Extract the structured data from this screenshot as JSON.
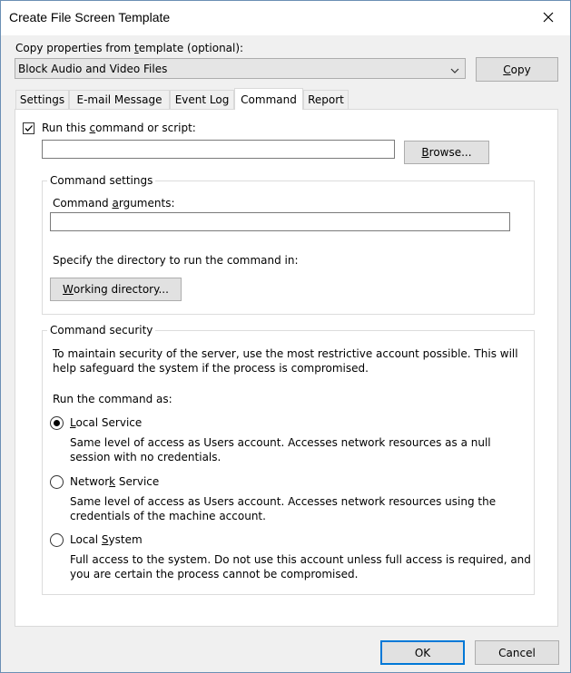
{
  "window": {
    "title": "Create File Screen Template",
    "close_icon": "close-icon"
  },
  "copy_from": {
    "label_pre": "Copy properties from ",
    "label_u": "t",
    "label_post": "emplate (optional):",
    "selected": "Block Audio and Video Files",
    "copy_button_pre": "",
    "copy_button_u": "C",
    "copy_button_post": "opy"
  },
  "tabs": [
    {
      "label": "Settings"
    },
    {
      "label": "E-mail Message"
    },
    {
      "label": "Event Log"
    },
    {
      "label": "Command"
    },
    {
      "label": "Report"
    }
  ],
  "command": {
    "run_checked": true,
    "run_label_pre": "Run this ",
    "run_label_u": "c",
    "run_label_post": "ommand or script:",
    "command_value": "",
    "browse_pre": "",
    "browse_u": "B",
    "browse_post": "rowse..."
  },
  "command_settings": {
    "group_label": "Command settings",
    "args_label_pre": "Command ",
    "args_label_u": "a",
    "args_label_post": "rguments:",
    "args_value": "",
    "dir_text": "Specify the directory to run the command in:",
    "workdir_pre": "",
    "workdir_u": "W",
    "workdir_post": "orking directory..."
  },
  "command_security": {
    "group_label": "Command security",
    "intro_line1": "To maintain security of the server, use the most restrictive account possible. This will",
    "intro_line2": "help safeguard the system if the process is compromised.",
    "run_as_label": "Run the command as:",
    "options": [
      {
        "pre": "",
        "u": "L",
        "post": "ocal Service",
        "desc1": "Same level of access as Users account. Accesses network resources as a null",
        "desc2": "session with no credentials.",
        "selected": true
      },
      {
        "pre": "Networ",
        "u": "k",
        "post": " Service",
        "desc1": "Same level of access as Users account. Accesses network resources using the",
        "desc2": "credentials of the machine account.",
        "selected": false
      },
      {
        "pre": "Local ",
        "u": "S",
        "post": "ystem",
        "desc1": "Full access to the system. Do not use this account unless full access is required, and",
        "desc2": "you are certain the process cannot be compromised.",
        "selected": false
      }
    ]
  },
  "footer": {
    "ok_label": "OK",
    "cancel_label": "Cancel"
  }
}
